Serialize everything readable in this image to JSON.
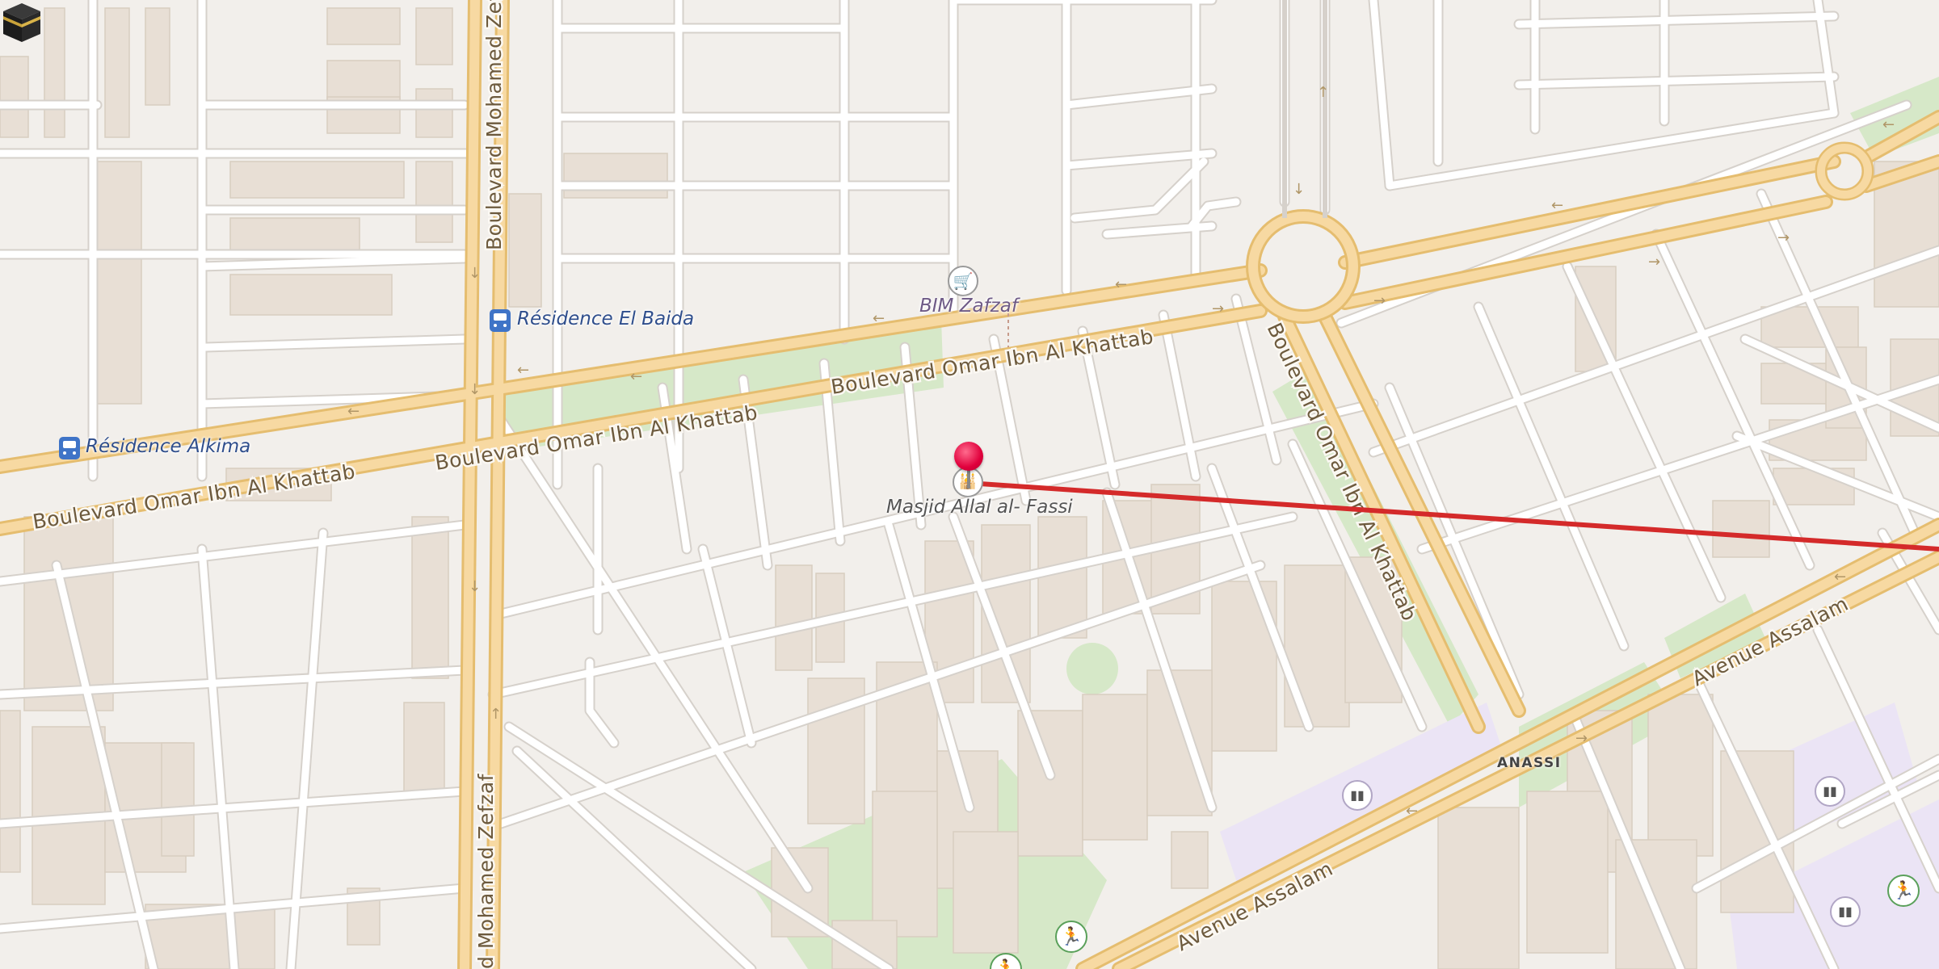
{
  "map": {
    "streets": {
      "boulevard_omar_w": "Boulevard Omar Ibn Al Khattab",
      "boulevard_omar_c": "Boulevard Omar Ibn Al Khattab",
      "boulevard_omar_e": "Boulevard Omar Ibn Al Khattab",
      "boulevard_omar_diag": "Boulevard Omar Ibn Al Khattab",
      "zefzaf_top": "Boulevard Mohamed Zefzaf",
      "zefzaf_bottom": "d Mohamed Zefzaf",
      "avenue_assalam_bottom": "Avenue Assalam",
      "avenue_assalam_right": "Avenue Assalam"
    },
    "places": {
      "anassi": "ANASSI"
    },
    "pois": {
      "residence_el_baida": {
        "label": "Résidence El Baida",
        "icon": "bus-stop-icon"
      },
      "residence_alkima": {
        "label": "Résidence Alkima",
        "icon": "bus-stop-icon"
      },
      "bim_zafzaf": {
        "label": "BIM Zafzaf",
        "icon": "shopping-cart-icon"
      },
      "masjid": {
        "label": "Masjid Allal al- Fassi",
        "icon": "mosque-icon"
      }
    },
    "markers": {
      "location_pin": {
        "icon": "location-pin-icon",
        "color": "#e0003c"
      },
      "kaaba": {
        "icon": "kaaba-icon"
      }
    },
    "qibla_line": {
      "color": "#d42a2a"
    },
    "colors": {
      "background": "#f2efeb",
      "primary_road": "#f7d9a2",
      "primary_road_casing": "#e5bd6f",
      "minor_road": "#ffffff",
      "minor_road_casing": "#d6d1cb",
      "park": "#d6e8c8",
      "school_area": "#ebe4f5",
      "building": "#e8dfd5"
    }
  }
}
